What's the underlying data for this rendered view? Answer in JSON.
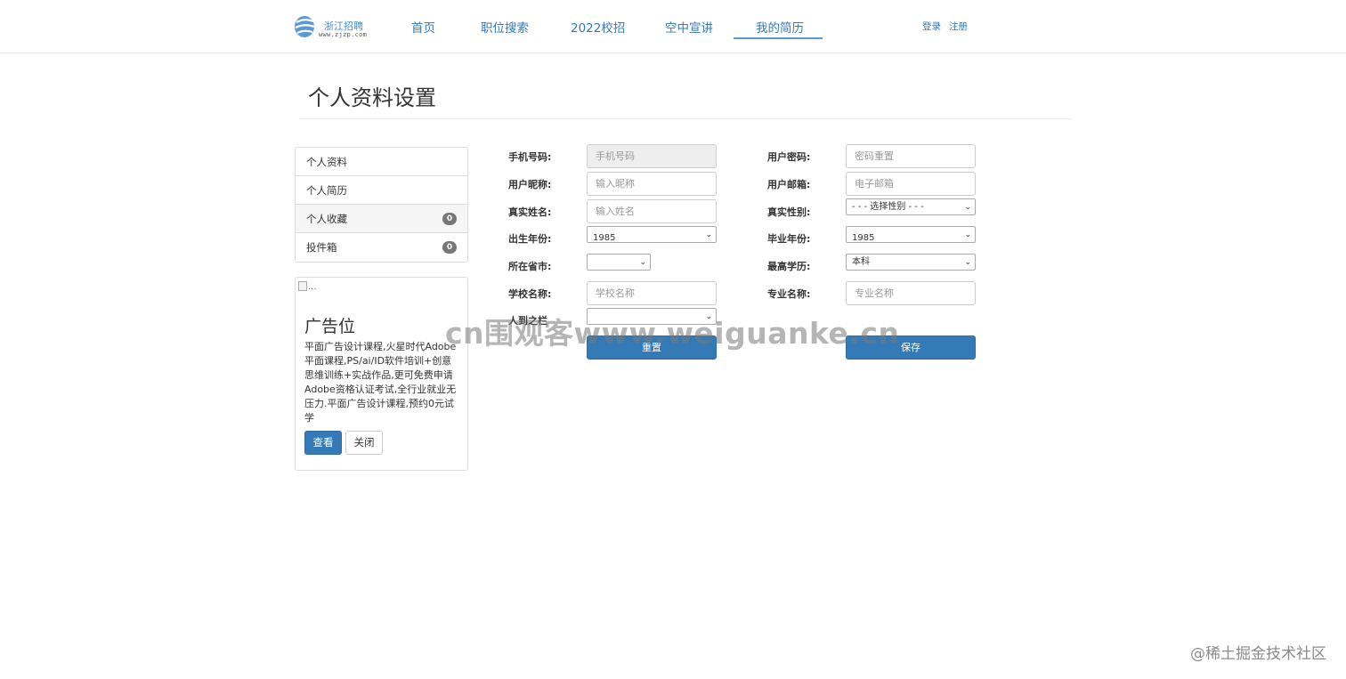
{
  "logo": {
    "name": "浙江招聘",
    "url": "www.zjzp.com"
  },
  "nav": {
    "items": [
      "首页",
      "职位搜索",
      "2022校招",
      "空中宣讲",
      "我的简历"
    ],
    "active_index": 4,
    "login": "登录",
    "register": "注册"
  },
  "page": {
    "title": "个人资料设置"
  },
  "sidebar": {
    "items": [
      {
        "label": "个人资料"
      },
      {
        "label": "个人简历"
      },
      {
        "label": "个人收藏",
        "badge": "0"
      },
      {
        "label": "投件箱",
        "badge": "0"
      }
    ]
  },
  "ad": {
    "img_alt": "...",
    "title": "广告位",
    "desc": "平面广告设计课程,火星时代Adobe平面课程,PS/ai/ID软件培训+创意思维训练+实战作品,更可免费申请Adobe资格认证考试,全行业就业无压力.平面广告设计课程,预约0元试学",
    "view_label": "查看",
    "close_label": "关闭"
  },
  "form": {
    "phone": {
      "label": "手机号码:",
      "placeholder": "手机号码"
    },
    "password": {
      "label": "用户密码:",
      "placeholder": "密码重置"
    },
    "nickname": {
      "label": "用户昵称:",
      "placeholder": "输入昵称"
    },
    "email": {
      "label": "用户邮箱:",
      "placeholder": "电子邮箱"
    },
    "realname": {
      "label": "真实姓名:",
      "placeholder": "输入姓名"
    },
    "gender": {
      "label": "真实性别:",
      "value": "- - - 选择性别 - - -"
    },
    "birth_year": {
      "label": "出生年份:",
      "value": "1985"
    },
    "grad_year": {
      "label": "毕业年份:",
      "value": "1985"
    },
    "city": {
      "label": "所在省市:",
      "value": ""
    },
    "education": {
      "label": "最高学历:",
      "value": "本科"
    },
    "school": {
      "label": "学校名称:",
      "placeholder": "学校名称"
    },
    "major": {
      "label": "专业名称:",
      "placeholder": "专业名称"
    },
    "extra": {
      "label": "人到之栏",
      "value": ""
    },
    "reset_label": "重置",
    "save_label": "保存"
  },
  "watermark": "cn围观客www.weiguanke.cn",
  "corner_watermark": "@稀土掘金技术社区"
}
